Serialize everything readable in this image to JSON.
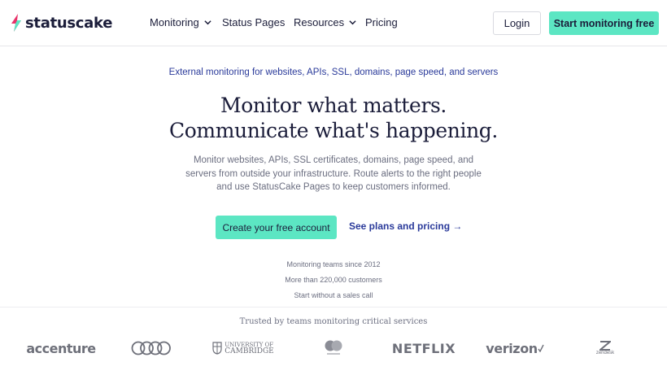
{
  "colors": {
    "accent": "#5ce6c3",
    "navy": "#1b1d3a",
    "link_blue": "#2a3a9a",
    "muted": "#6b6e80",
    "logo_pink": "#e8336a"
  },
  "header": {
    "logo_text": "statuscake",
    "nav": {
      "monitoring": "Monitoring",
      "status_pages": "Status Pages",
      "resources": "Resources",
      "pricing": "Pricing"
    },
    "login_label": "Login",
    "start_label": "Start monitoring free"
  },
  "hero": {
    "eyebrow": "External monitoring for websites, APIs, SSL, domains, page speed, and servers",
    "headline_line1": "Monitor what matters.",
    "headline_line2": "Communicate what's happening.",
    "subtext": "Monitor websites, APIs, SSL certificates, domains, page speed, and servers from outside your infrastructure. Route alerts to the right people and use StatusCake Pages to keep customers informed.",
    "cta_primary": "Create your free account",
    "cta_secondary": "See plans and pricing →",
    "facts": [
      "Monitoring teams since 2012",
      "More than 220,000 customers",
      "Start without a sales call"
    ]
  },
  "trusted": {
    "title": "Trusted by teams monitoring critical services",
    "brands": {
      "accenture": "accenture",
      "cambridge_line1": "UNIVERSITY OF",
      "cambridge_line2": "CAMBRIDGE",
      "netflix": "NETFLIX",
      "verizon": "verizon",
      "zendesk": "zendesk"
    }
  }
}
